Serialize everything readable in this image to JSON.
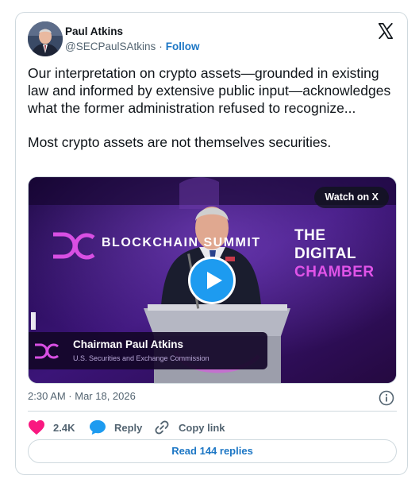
{
  "author": {
    "name": "Paul Atkins",
    "handle": "@SECPaulSAtkins",
    "separator": "·",
    "follow_label": "Follow"
  },
  "tweet": {
    "paragraphs": [
      "Our interpretation on crypto assets—grounded in existing law and informed by extensive public input—acknowledges what the former administration refused to recognize...",
      "Most crypto assets are not themselves securities."
    ]
  },
  "media": {
    "watch_label": "Watch on X",
    "lower_third_name": "Chairman Paul Atkins",
    "lower_third_title": "U.S. Securities and Exchange Commission",
    "banner_left": "BLOCKCHAIN SUMMIT",
    "banner_right_line1": "THE DIGITAL",
    "banner_right_line2": "CHAMBER",
    "colors": {
      "background": "#2a0d59",
      "accent": "#e053e8",
      "play": "#1d9bf0"
    }
  },
  "meta": {
    "timestamp": "2:30 AM · Mar 18, 2026"
  },
  "actions": {
    "like_count": "2.4K",
    "reply_label": "Reply",
    "copy_label": "Copy link"
  },
  "replies_button": "Read 144 replies",
  "icons": [
    "x-logo-icon",
    "info-icon",
    "heart-icon",
    "reply-bubble-icon",
    "link-icon",
    "play-icon"
  ],
  "colors": {
    "like": "#f91880",
    "reply": "#1d9bf0",
    "link": "#1d77c5",
    "muted": "#536471"
  }
}
